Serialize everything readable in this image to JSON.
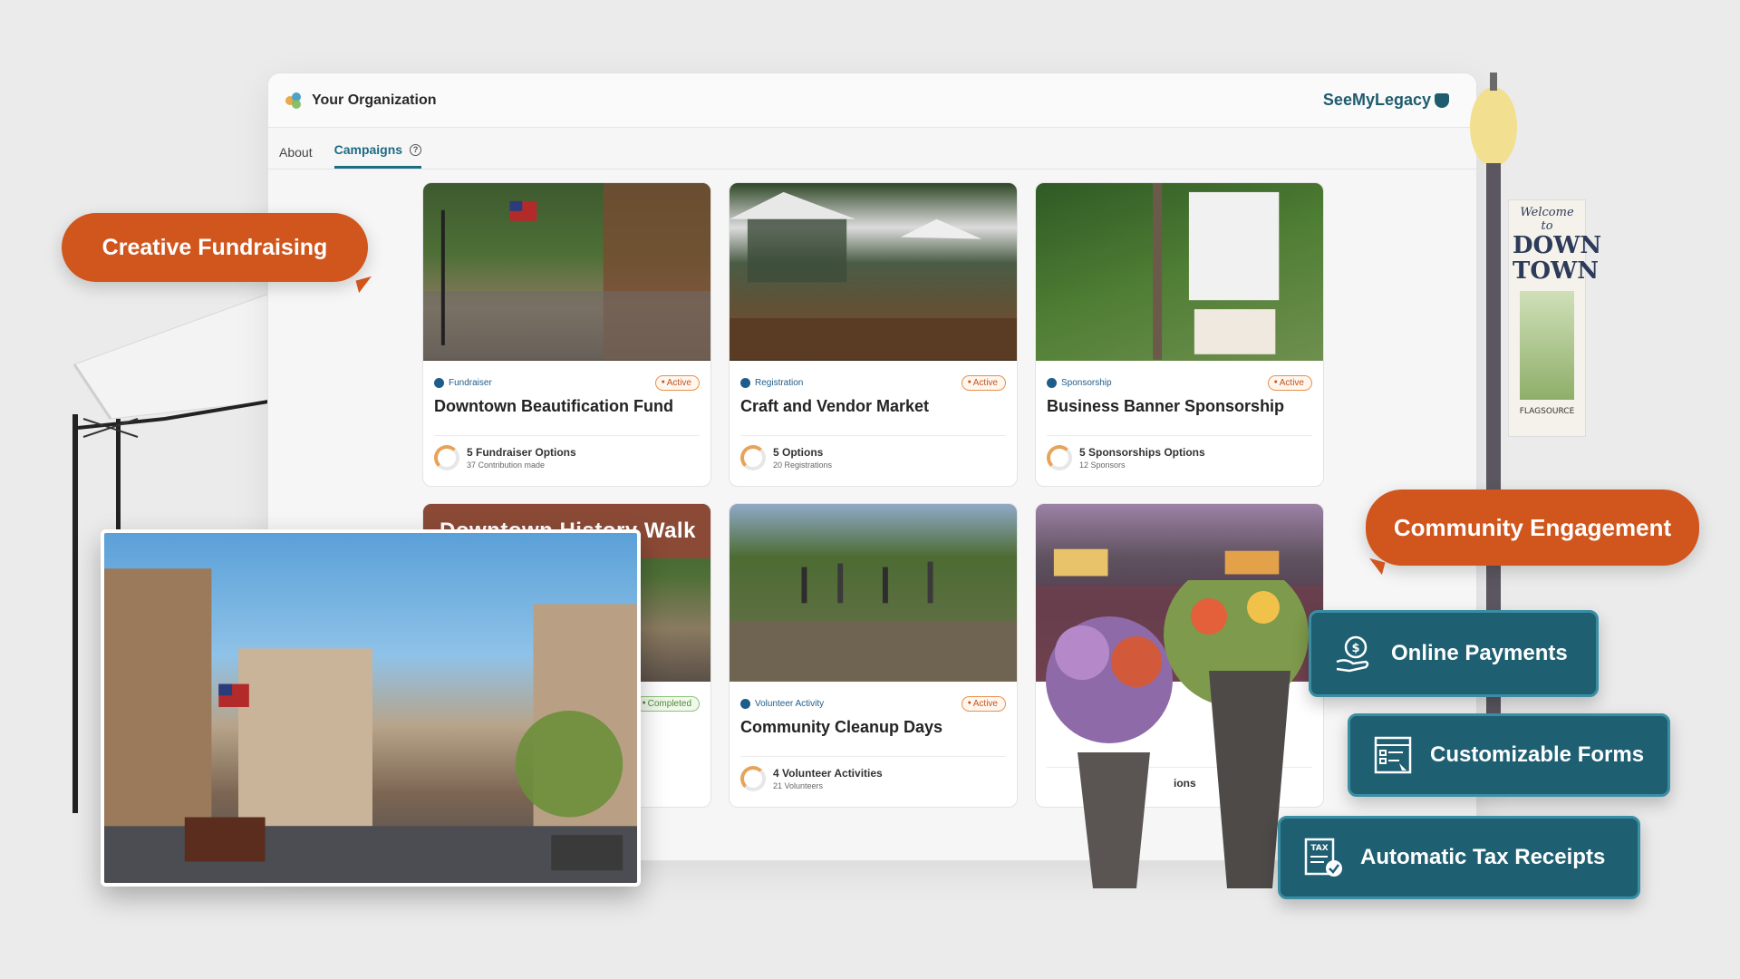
{
  "header": {
    "org_name": "Your Organization",
    "brand": "SeeMyLegacy"
  },
  "tabs": [
    {
      "label": "About",
      "active": false
    },
    {
      "label": "Campaigns",
      "active": true
    }
  ],
  "campaigns": [
    {
      "type": "Fundraiser",
      "status": "Active",
      "title": "Downtown Beautification Fund",
      "stat_main": "5 Fundraiser Options",
      "stat_sub": "37 Contribution made"
    },
    {
      "type": "Registration",
      "status": "Active",
      "title": "Craft and Vendor Market",
      "stat_main": "5 Options",
      "stat_sub": "20 Registrations"
    },
    {
      "type": "Sponsorship",
      "status": "Active",
      "title": "Business Banner Sponsorship",
      "stat_main": "5 Sponsorships Options",
      "stat_sub": "12 Sponsors"
    },
    {
      "title": "Downtown History Walk",
      "status": "Completed"
    },
    {
      "type": "Volunteer Activity",
      "status": "Active",
      "title": "Community Cleanup Days",
      "stat_main": "4 Volunteer Activities",
      "stat_sub": "21 Volunteers"
    },
    {
      "stat_main_fragment": "ions"
    }
  ],
  "callouts": {
    "creative_fundraising": "Creative Fundraising",
    "community_engagement": "Community Engagement"
  },
  "features": {
    "online_payments": "Online Payments",
    "customizable_forms": "Customizable Forms",
    "automatic_tax_receipts": "Automatic Tax Receipts"
  },
  "banner": {
    "line1": "Welcome to",
    "line2": "DOWN",
    "line3": "TOWN",
    "credit": "FLAGSOURCE"
  },
  "colors": {
    "accent_orange": "#d0561d",
    "feature_teal": "#1e5f72",
    "brand_teal": "#1e5c6e"
  }
}
